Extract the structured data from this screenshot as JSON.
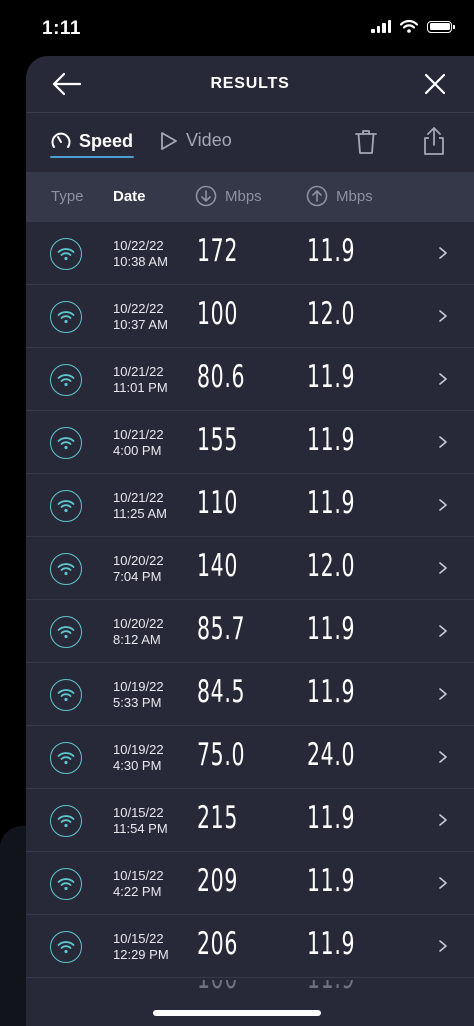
{
  "status_bar": {
    "time": "1:11"
  },
  "header": {
    "title": "RESULTS"
  },
  "tabs": {
    "speed": "Speed",
    "video": "Video"
  },
  "columns": {
    "type": "Type",
    "date": "Date",
    "down": "Mbps",
    "up": "Mbps"
  },
  "results": [
    {
      "date": "10/22/22",
      "time": "10:38 AM",
      "down": "172",
      "up": "11.9"
    },
    {
      "date": "10/22/22",
      "time": "10:37 AM",
      "down": "100",
      "up": "12.0"
    },
    {
      "date": "10/21/22",
      "time": "11:01 PM",
      "down": "80.6",
      "up": "11.9"
    },
    {
      "date": "10/21/22",
      "time": "4:00 PM",
      "down": "155",
      "up": "11.9"
    },
    {
      "date": "10/21/22",
      "time": "11:25 AM",
      "down": "110",
      "up": "11.9"
    },
    {
      "date": "10/20/22",
      "time": "7:04 PM",
      "down": "140",
      "up": "12.0"
    },
    {
      "date": "10/20/22",
      "time": "8:12 AM",
      "down": "85.7",
      "up": "11.9"
    },
    {
      "date": "10/19/22",
      "time": "5:33 PM",
      "down": "84.5",
      "up": "11.9"
    },
    {
      "date": "10/19/22",
      "time": "4:30 PM",
      "down": "75.0",
      "up": "24.0"
    },
    {
      "date": "10/15/22",
      "time": "11:54 PM",
      "down": "215",
      "up": "11.9"
    },
    {
      "date": "10/15/22",
      "time": "4:22 PM",
      "down": "209",
      "up": "11.9"
    },
    {
      "date": "10/15/22",
      "time": "12:29 PM",
      "down": "206",
      "up": "11.9"
    }
  ],
  "accent_color": "#4a9fd1",
  "wifi_icon_color": "#5fc6cf"
}
